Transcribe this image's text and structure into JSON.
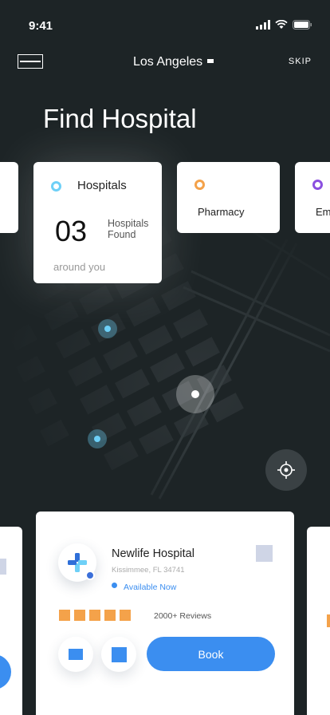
{
  "status_bar": {
    "time": "9:41"
  },
  "header": {
    "location": "Los Angeles",
    "skip_label": "SKIP"
  },
  "page_title": "Find Hospital",
  "categories": [
    {
      "label": "Hospitals",
      "count": "03",
      "count_label": "Hospitals Found",
      "subtitle": "around you",
      "color": "#6ed0f7"
    },
    {
      "label": "Pharmacy",
      "color": "#f4a24a"
    },
    {
      "label": "Emergency",
      "color": "#8b4fe0"
    }
  ],
  "hospital_card": {
    "name": "Newlife Hospital",
    "address": "Kissimmee, FL 34741",
    "availability": "Available Now",
    "rating_stars": 5,
    "reviews": "2000+ Reviews",
    "book_label": "Book"
  },
  "colors": {
    "background": "#1d2426",
    "accent": "#3b8ef0",
    "star": "#f4a24a"
  },
  "icons": [
    "back-arrow-icon",
    "chevron-down-icon",
    "signal-icon",
    "wifi-icon",
    "battery-icon",
    "locate-icon",
    "medical-cross-icon",
    "phone-icon",
    "directions-icon",
    "favorite-icon"
  ]
}
